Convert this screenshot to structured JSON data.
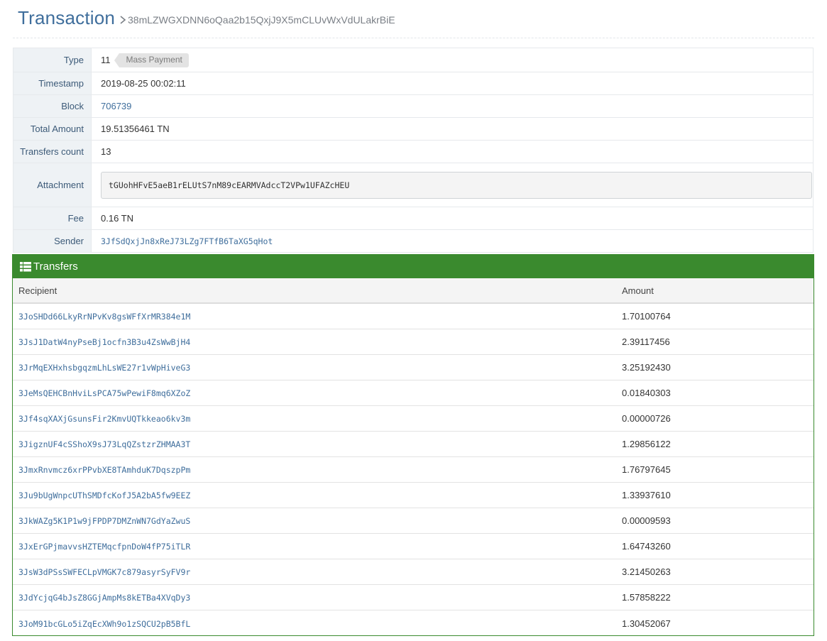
{
  "header": {
    "title": "Transaction",
    "transaction_id": "38mLZWGXDNN6oQaa2b15QxjJ9X5mCLUvWxVdULakrBiE"
  },
  "info": {
    "type": {
      "label": "Type",
      "value": "11",
      "badge": "Mass Payment"
    },
    "timestamp": {
      "label": "Timestamp",
      "value": "2019-08-25 00:02:11"
    },
    "block": {
      "label": "Block",
      "value": "706739"
    },
    "total_amount": {
      "label": "Total Amount",
      "value": "19.51356461 TN"
    },
    "transfers_count": {
      "label": "Transfers count",
      "value": "13"
    },
    "attachment": {
      "label": "Attachment",
      "value": "tGUohHFvE5aeB1rELUtS7nM89cEARMVAdccT2VPw1UFAZcHEU"
    },
    "fee": {
      "label": "Fee",
      "value": "0.16 TN"
    },
    "sender": {
      "label": "Sender",
      "value": "3JfSdQxjJn8xReJ73LZg7FTfB6TaXG5qHot"
    }
  },
  "transfers": {
    "title": "Transfers",
    "icon": "list-icon",
    "columns": {
      "recipient": "Recipient",
      "amount": "Amount"
    },
    "rows": [
      {
        "recipient": "3JoSHDd66LkyRrNPvKv8gsWFfXrMR384e1M",
        "amount": "1.70100764"
      },
      {
        "recipient": "3JsJ1DatW4nyPseBj1ocfn3B3u4ZsWwBjH4",
        "amount": "2.39117456"
      },
      {
        "recipient": "3JrMqEXHxhsbgqzmLhLsWE27r1vWpHiveG3",
        "amount": "3.25192430"
      },
      {
        "recipient": "3JeMsQEHCBnHviLsPCA75wPewiF8mq6XZoZ",
        "amount": "0.01840303"
      },
      {
        "recipient": "3Jf4sqXAXjGsunsFir2KmvUQTkkeao6kv3m",
        "amount": "0.00000726"
      },
      {
        "recipient": "3JigznUF4cSShoX9sJ73LqQZstzrZHMAA3T",
        "amount": "1.29856122"
      },
      {
        "recipient": "3JmxRnvmcz6xrPPvbXE8TAmhduK7DqszpPm",
        "amount": "1.76797645"
      },
      {
        "recipient": "3Ju9bUgWnpcUThSMDfcKofJ5A2bA5fw9EEZ",
        "amount": "1.33937610"
      },
      {
        "recipient": "3JkWAZg5K1P1w9jFPDP7DMZnWN7GdYaZwuS",
        "amount": "0.00009593"
      },
      {
        "recipient": "3JxErGPjmavvsHZTEMqcfpnDoW4fP75iTLR",
        "amount": "1.64743260"
      },
      {
        "recipient": "3JsW3dPSsSWFECLpVMGK7c879asyrSyFV9r",
        "amount": "3.21450263"
      },
      {
        "recipient": "3JdYcjqG4bJsZ8GGjAmpMs8kETBa4XVqDy3",
        "amount": "1.57858222"
      },
      {
        "recipient": "3JoM91bcGLo5iZqEcXWh9o1zSQCU2pB5BfL",
        "amount": "1.30452067"
      }
    ]
  }
}
